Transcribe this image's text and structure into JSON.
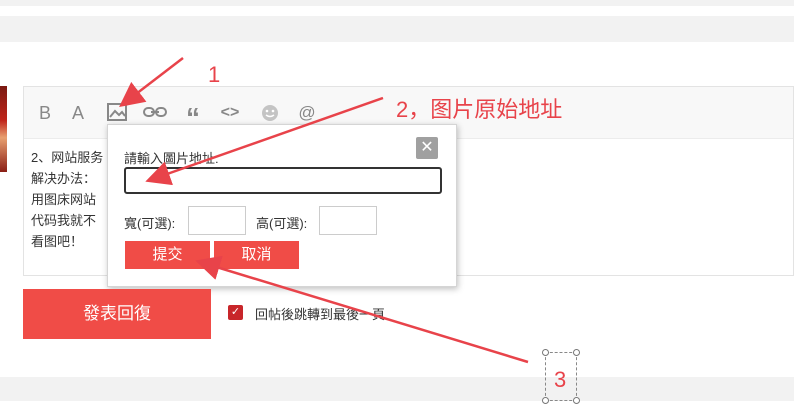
{
  "toolbar": {
    "items": [
      {
        "name": "bold-icon",
        "glyph": "B"
      },
      {
        "name": "font-size-icon",
        "glyph": "A"
      },
      {
        "name": "image-icon",
        "glyph": ""
      },
      {
        "name": "link-icon",
        "glyph": ""
      },
      {
        "name": "quote-icon",
        "glyph": "“"
      },
      {
        "name": "code-icon",
        "glyph": "<>"
      },
      {
        "name": "emoji-icon",
        "glyph": ""
      },
      {
        "name": "at-icon",
        "glyph": "@"
      }
    ]
  },
  "editor": {
    "lines": [
      "2、网站服务",
      "解决办法：",
      "用图床网站",
      "代码我就不",
      "看图吧！"
    ]
  },
  "popup": {
    "label": "請輸入圖片地址:",
    "url_value": "",
    "width_label": "寬(可選):",
    "height_label": "高(可選):",
    "submit_label": "提交",
    "cancel_label": "取消",
    "close_glyph": "✕"
  },
  "reply": {
    "button_label": "發表回復",
    "checkbox_checked": true,
    "checkbox_label": "回帖後跳轉到最後一頁"
  },
  "annotations": {
    "label_1": "1",
    "label_2": "2，图片原始地址",
    "label_3": "3"
  },
  "colors": {
    "accent": "#f04c47",
    "annotation": "#e8434a",
    "icon": "#888888"
  }
}
